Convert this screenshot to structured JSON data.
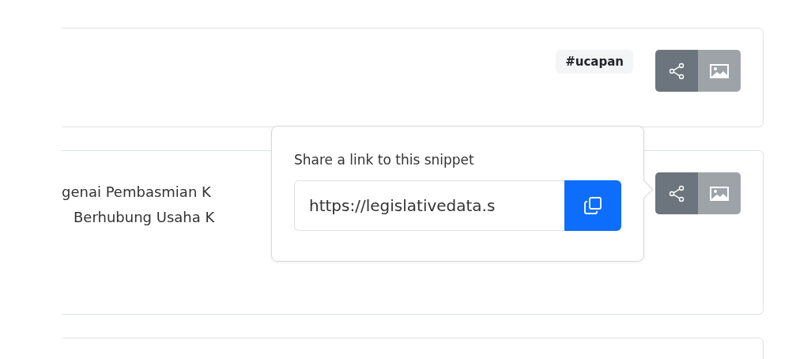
{
  "cards": [
    {
      "tag": "#ucapan"
    },
    {
      "lines": [
        "genai Pembasmian K",
        "Berhubung Usaha K"
      ]
    }
  ],
  "popover": {
    "title": "Share a link to this snippet",
    "url": "https://legislativedata.s"
  }
}
